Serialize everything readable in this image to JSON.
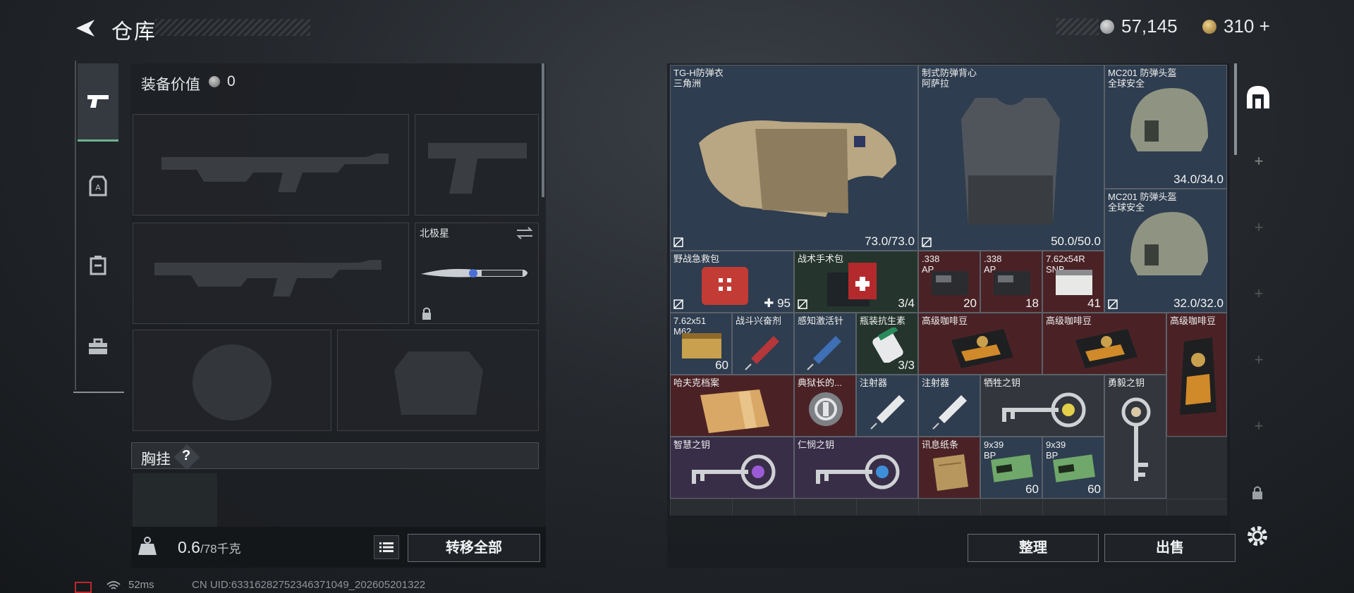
{
  "header": {
    "title": "仓库",
    "currency_silver": "57,145",
    "currency_gold": "310",
    "gold_add": "+"
  },
  "left": {
    "equip_value_label": "装备价值",
    "equip_value": "0",
    "melee_name": "北极星",
    "chest_label": "胸挂",
    "chest_help": "?",
    "weight": "0.6",
    "weight_max": "/78千克",
    "transfer_all": "转移全部"
  },
  "items": {
    "armor1": {
      "name": "TG-H防弹衣",
      "sub": "三角洲",
      "dur": "73.0/73.0"
    },
    "armor2": {
      "name": "制式防弹背心",
      "sub": "阿萨拉",
      "dur": "50.0/50.0"
    },
    "helmet1": {
      "name": "MC201 防弹头盔",
      "sub": "全球安全",
      "dur": "34.0/34.0"
    },
    "helmet2": {
      "name": "MC201 防弹头盔",
      "sub": "全球安全",
      "dur": "32.0/32.0"
    },
    "medkit": {
      "name": "野战急救包",
      "qty": "95"
    },
    "surgkit": {
      "name": "战术手术包",
      "qty": "3/4"
    },
    "ammo338a": {
      "name": ".338",
      "sub": "AP",
      "qty": "20"
    },
    "ammo338b": {
      "name": ".338",
      "sub": "AP",
      "qty": "18"
    },
    "ammo762r": {
      "name": "7.62x54R",
      "sub": "SNB",
      "qty": "41"
    },
    "ammo762x51": {
      "name": "7.62x51",
      "sub": "M62",
      "qty": "60"
    },
    "stim": {
      "name": "战斗兴奋剂"
    },
    "perception": {
      "name": "感知激活针"
    },
    "antibiotic": {
      "name": "瓶装抗生素",
      "qty": "3/3"
    },
    "coffee1": {
      "name": "高级咖啡豆"
    },
    "coffee2": {
      "name": "高级咖啡豆"
    },
    "coffee3": {
      "name": "高级咖啡豆"
    },
    "havk": {
      "name": "哈夫克档案"
    },
    "warden": {
      "name": "典狱长的..."
    },
    "injector1": {
      "name": "注射器"
    },
    "injector2": {
      "name": "注射器"
    },
    "key_sacrifice": {
      "name": "牺牲之钥"
    },
    "key_courage": {
      "name": "勇毅之钥"
    },
    "key_wisdom": {
      "name": "智慧之钥"
    },
    "key_mercy": {
      "name": "仁悯之钥"
    },
    "note": {
      "name": "讯息纸条"
    },
    "ammo9a": {
      "name": "9x39",
      "sub": "BP",
      "qty": "60"
    },
    "ammo9b": {
      "name": "9x39",
      "sub": "BP",
      "qty": "60"
    }
  },
  "actions": {
    "sort": "整理",
    "sell": "出售"
  },
  "status": {
    "ping": "52ms",
    "uid": "CN UID:6331628275234637104​9_202605201322"
  },
  "colors": {
    "accent_green": "#6fb28d",
    "rare_blue": "#2e3d4f",
    "epic_purple": "#392e48",
    "legendary_red": "#4a2226"
  }
}
